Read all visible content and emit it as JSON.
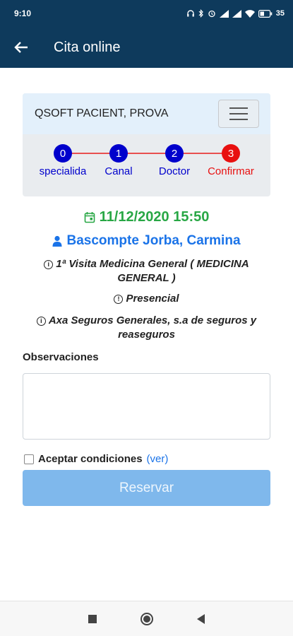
{
  "status_bar": {
    "time": "9:10",
    "battery": "35"
  },
  "app_bar": {
    "title": "Cita online",
    "back_icon": "arrow-left-icon"
  },
  "card": {
    "patient": "QSOFT PACIENT, PROVA",
    "menu_icon": "hamburger-menu-icon",
    "steps": [
      {
        "number": "0",
        "label": "specialida",
        "color": "#0000cc"
      },
      {
        "number": "1",
        "label": "Canal",
        "color": "#0000cc"
      },
      {
        "number": "2",
        "label": "Doctor",
        "color": "#0000cc"
      },
      {
        "number": "3",
        "label": "Confirmar",
        "color": "#e81010"
      }
    ]
  },
  "appointment": {
    "datetime": "11/12/2020 15:50",
    "doctor": "Bascompte Jorba, Carmina",
    "visit": "1ª Visita Medicina General ( MEDICINA GENERAL )",
    "modality": "Presencial",
    "insurer": "Axa Seguros Generales, s.a de seguros y reaseguros"
  },
  "form": {
    "observations_label": "Observaciones",
    "observations_value": "",
    "accept_label": "Aceptar condiciones",
    "accept_link": "(ver)",
    "accept_checked": false,
    "reserve_label": "Reservar"
  },
  "colors": {
    "primary": "#0e3a5c",
    "green": "#28a745",
    "blue": "#1a73e8",
    "button_disabled": "#7fb8ec",
    "step_line": "#e85050"
  }
}
